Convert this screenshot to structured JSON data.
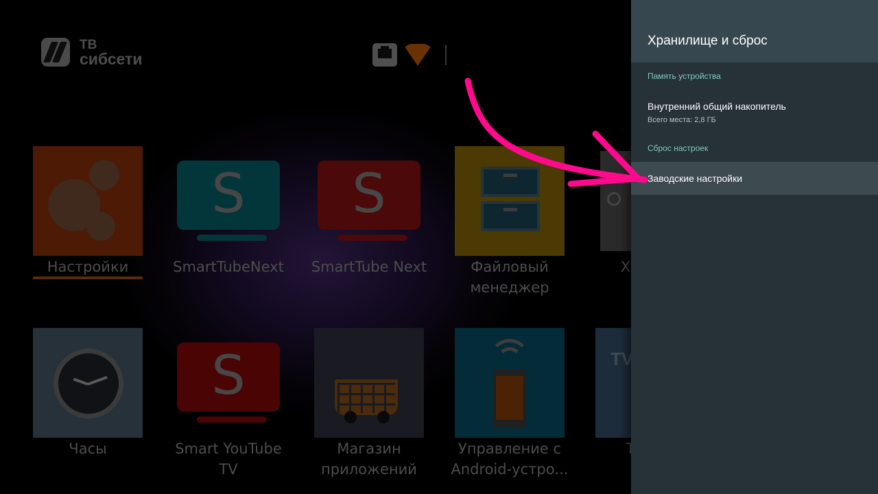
{
  "launcher": {
    "logo": {
      "line1": "ТВ",
      "line2": "сибсети"
    },
    "status": {
      "network_icon": "ethernet-icon",
      "wifi_icon": "wifi-icon"
    },
    "apps_row1": [
      {
        "label": "Настройки",
        "icon": "gears-icon",
        "focused": true
      },
      {
        "label": "SmartTubeNext",
        "icon": "smarttube-icon"
      },
      {
        "label": "SmartTube Next",
        "icon": "smarttube-icon"
      },
      {
        "label_line1": "Файловый",
        "label_line2": "менеджер",
        "icon": "file-cabinet-icon"
      },
      {
        "label": "Х",
        "icon": "partial-app-icon"
      }
    ],
    "apps_row2": [
      {
        "label": "Часы",
        "icon": "clock-icon"
      },
      {
        "label_line1": "Smart YouTube",
        "label_line2": "TV",
        "icon": "smarttube-icon"
      },
      {
        "label_line1": "Магазин",
        "label_line2": "приложений",
        "icon": "shopping-cart-icon"
      },
      {
        "label_line1": "Управление с",
        "label_line2": "Android-устро...",
        "icon": "remote-phone-icon"
      },
      {
        "label": "Т",
        "icon": "partial-tv-icon"
      }
    ]
  },
  "panel": {
    "title": "Хранилище и сброс",
    "sections": {
      "storage": {
        "header": "Память устройства",
        "item_title": "Внутренний общий накопитель",
        "item_summary": "Всего места: 2,8 ГБ"
      },
      "reset": {
        "header": "Сброс настроек",
        "item_title": "Заводские настройки"
      }
    }
  },
  "annotation": {
    "arrow_color": "#ff0a8c"
  },
  "colors": {
    "panel_bg": "#263238",
    "panel_header": "#37474f",
    "section_accent": "#80cbc4",
    "focus_row": "#3d4a50"
  }
}
